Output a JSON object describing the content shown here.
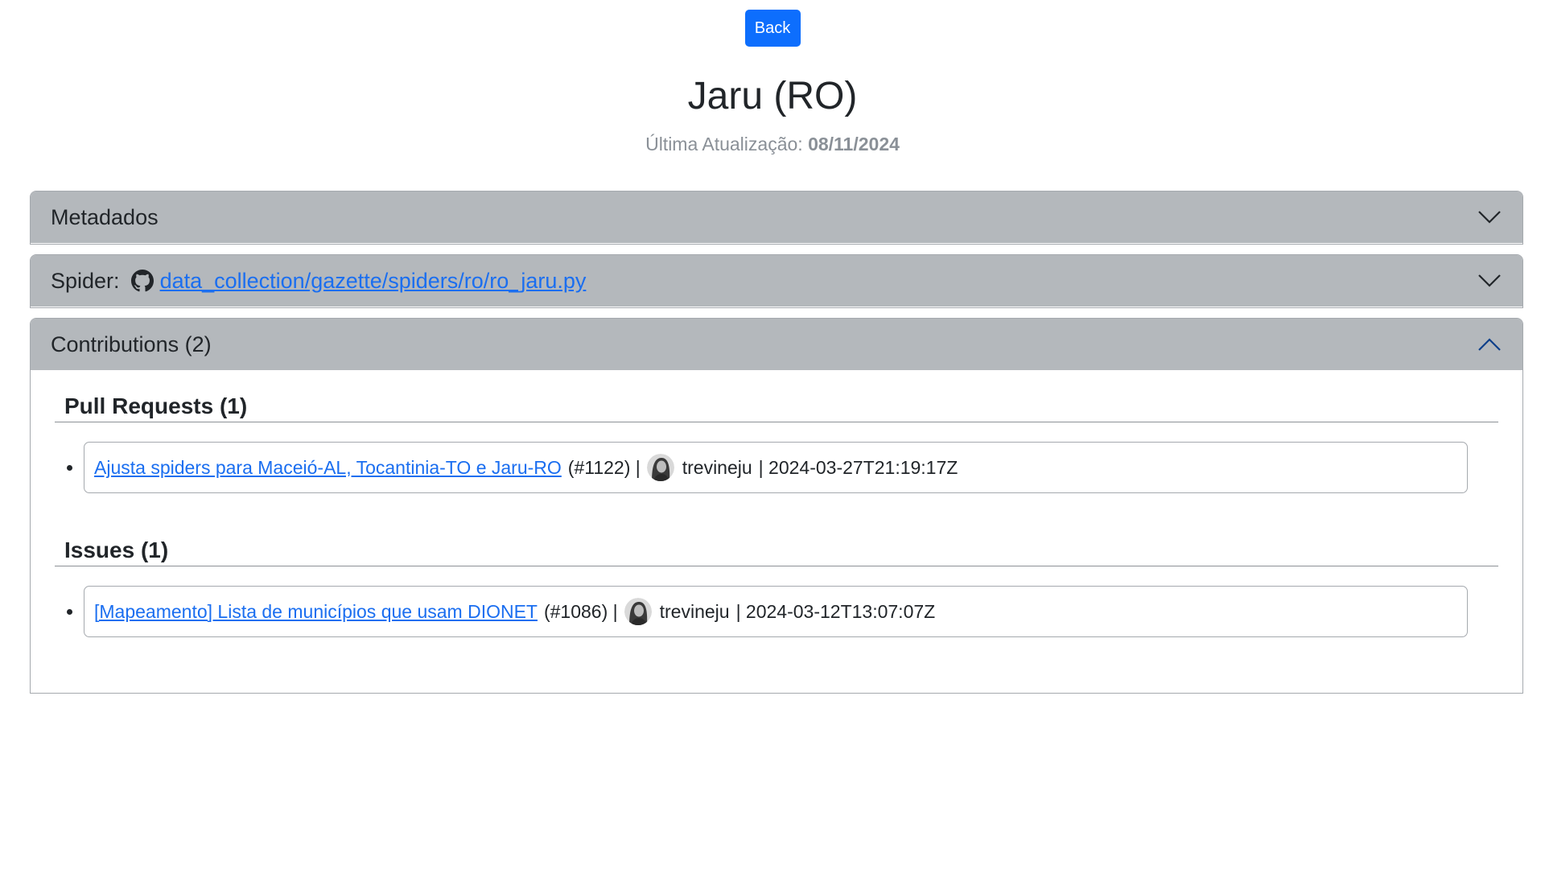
{
  "back_button": {
    "label": "Back"
  },
  "page": {
    "title": "Jaru (RO)",
    "updated_label": "Última Atualização:",
    "updated_date": "08/11/2024"
  },
  "accordion": {
    "metadata": {
      "label": "Metadados",
      "expanded": false
    },
    "spider": {
      "label": "Spider:",
      "icon": "github-icon",
      "path": "data_collection/gazette/spiders/ro/ro_jaru.py",
      "expanded": false
    },
    "contributions": {
      "label": "Contributions (2)",
      "expanded": true,
      "pull_requests": {
        "title": "Pull Requests (1)",
        "items": [
          {
            "title": "Ajusta spiders para Maceió-AL, Tocantinia-TO e Jaru-RO",
            "number": "(#1122) |",
            "author": "trevineju",
            "date": "| 2024-03-27T21:19:17Z"
          }
        ]
      },
      "issues": {
        "title": "Issues (1)",
        "items": [
          {
            "title": "[Mapeamento] Lista de municípios que usam DIONET",
            "number": "(#1086) |",
            "author": "trevineju",
            "date": "| 2024-03-12T13:07:07Z"
          }
        ]
      }
    }
  },
  "colors": {
    "primary": "#0d6efd",
    "link": "#1a6ef0",
    "header_bg": "#b4b8bc",
    "muted": "#8a9097"
  }
}
